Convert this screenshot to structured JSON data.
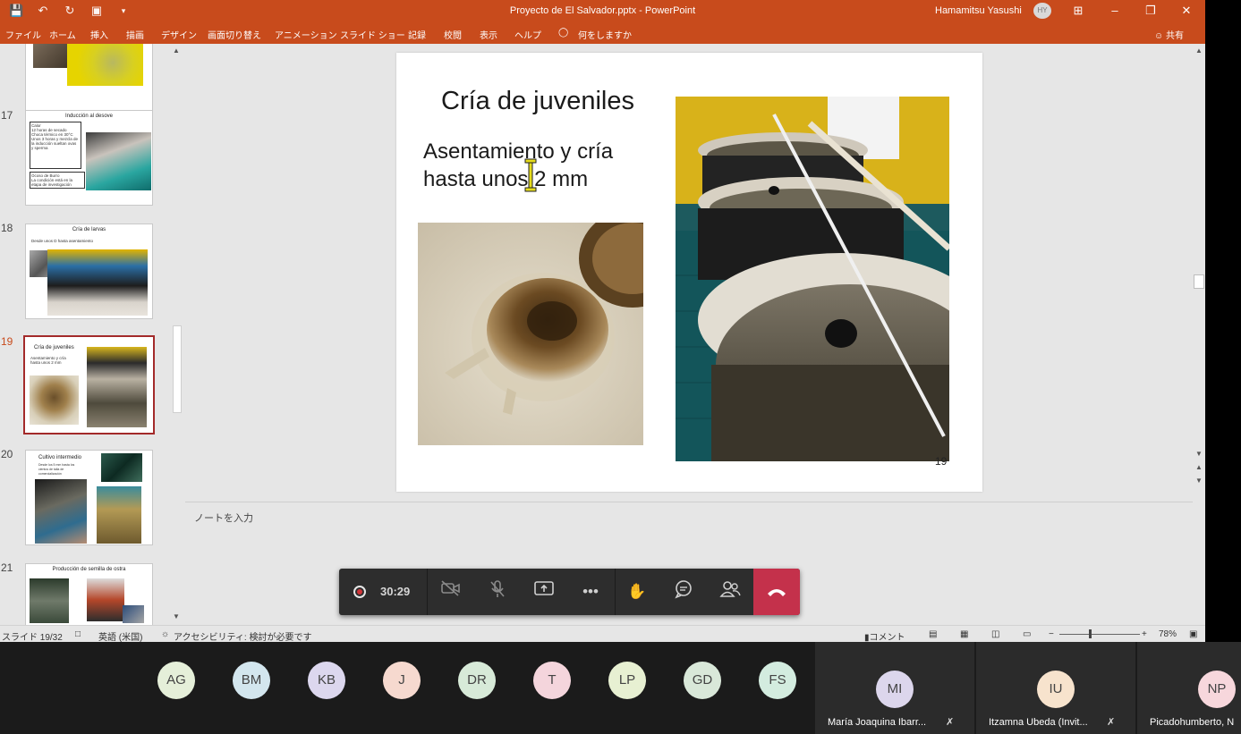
{
  "colors": {
    "ribbon": "#c84b1c",
    "active_slide_border": "#a32a2a",
    "hangup": "#c4314b",
    "teams_bar": "#2d2d2d"
  },
  "window": {
    "doc_title": "Proyecto de El Salvador.pptx - PowerPoint",
    "user_name": "Hamamitsu Yasushi",
    "user_initials": "HY",
    "quick_access_icons": [
      "save-icon",
      "undo-icon",
      "redo-icon",
      "present-icon",
      "customize-icon"
    ]
  },
  "ribbon": {
    "tabs": [
      "ファイル",
      "ホーム",
      "挿入",
      "描画",
      "デザイン",
      "画面切り替え",
      "アニメーション",
      "スライド ショー",
      "記録",
      "校閲",
      "表示",
      "ヘルプ",
      "何をしますか"
    ],
    "share": "共有"
  },
  "thumbnails": [
    {
      "num": "17",
      "title": "Inducción al desove",
      "text": [
        "Calor",
        "12 horas de secado",
        "Choca térmico en 30°C",
        "Unos 3 horas y mezcla de",
        "la inducción sueltan ovas",
        "y sperma",
        "Ocoso de Burro",
        "La condición está en la",
        "etapa de investigación"
      ]
    },
    {
      "num": "18",
      "title": "Cría de larvas",
      "text": [
        "Desde unos D hasta asentamiento"
      ]
    },
    {
      "num": "19",
      "title": "Cría de juveniles",
      "text": [
        "Asentamiento y cría",
        "hasta unos 2 mm"
      ]
    },
    {
      "num": "20",
      "title": "Cultivo intermedio",
      "text": [
        "Desde los 5 mm hasta los",
        "cientos de talla de",
        "comercialización"
      ]
    },
    {
      "num": "21",
      "title": "Producción de semilla de ostra",
      "text": []
    }
  ],
  "slide": {
    "title": "Cría de juveniles",
    "body_line1": "Asentamiento y cría",
    "body_line2": "hasta unos 2 mm",
    "number": "19"
  },
  "notes": {
    "placeholder": "ノートを入力"
  },
  "statusbar": {
    "slide_counter": "スライド 19/32",
    "language": "英語 (米国)",
    "accessibility": "アクセシビリティ: 検討が必要です",
    "comments": "コメント",
    "zoom_percent": "78%",
    "zoom_level": 0.78
  },
  "call": {
    "timer": "30:29"
  },
  "participants": [
    {
      "initials": "AG",
      "color": "#e5efd9"
    },
    {
      "initials": "BM",
      "color": "#d3e6ee"
    },
    {
      "initials": "KB",
      "color": "#dcd7ee"
    },
    {
      "initials": "J",
      "color": "#f6d9cf"
    },
    {
      "initials": "DR",
      "color": "#d7ead8"
    },
    {
      "initials": "T",
      "color": "#f4d5dc"
    },
    {
      "initials": "LP",
      "color": "#e7f0d2"
    },
    {
      "initials": "GD",
      "color": "#d9e8d9"
    },
    {
      "initials": "FS",
      "color": "#d3ecdf"
    }
  ],
  "participant_tiles": [
    {
      "initials": "MI",
      "name": "María Joaquina Ibarr...",
      "color": "#dcd6ec"
    },
    {
      "initials": "IU",
      "name": "Itzamna Ubeda (Invit...",
      "color": "#f7e3cd"
    },
    {
      "initials": "NP",
      "name": "Picadohumberto, N",
      "color": "#f7d7dc"
    }
  ]
}
